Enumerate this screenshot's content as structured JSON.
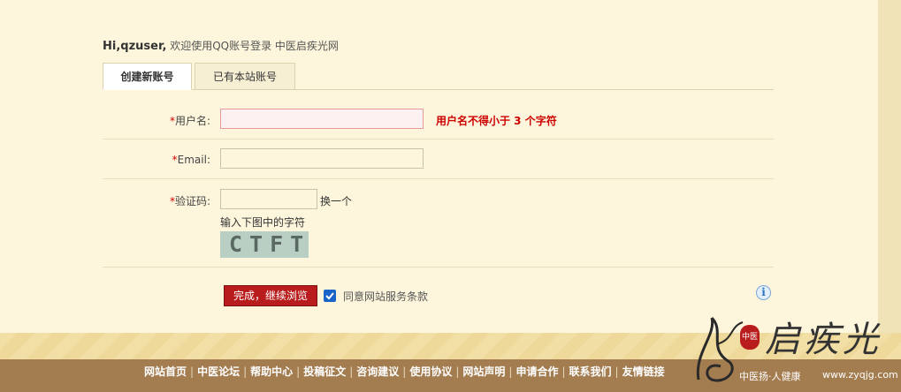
{
  "greeting": {
    "hi": "Hi,qzuser,",
    "message": " 欢迎使用QQ账号登录 中医启疾光网"
  },
  "tabs": [
    {
      "label": "创建新账号",
      "active": true
    },
    {
      "label": "已有本站账号",
      "active": false
    }
  ],
  "form": {
    "required_mark": "*",
    "username": {
      "label": "用户名:",
      "value": "",
      "error": "用户名不得小于 3 个字符"
    },
    "email": {
      "label": "Email:",
      "value": ""
    },
    "captcha": {
      "label": "验证码:",
      "value": "",
      "refresh": "换一个",
      "hint": "输入下图中的字符",
      "image_text": "CTFT"
    },
    "submit": "完成，继续浏览",
    "agree": {
      "checked": true,
      "label": "同意网站服务条款"
    },
    "info_icon": "i"
  },
  "footer": {
    "links": [
      "网站首页",
      "中医论坛",
      "帮助中心",
      "投稿征文",
      "咨询建议",
      "使用协议",
      "网站声明",
      "申请合作",
      "联系我们",
      "友情链接"
    ],
    "separator": "|"
  },
  "logo": {
    "name": "启疾光",
    "seal": "中医",
    "slogan": "中医扬·人健康",
    "url": "www.zyqjg.com"
  },
  "colors": {
    "accent_red": "#b81c1c",
    "background": "#fdf6dc",
    "footer": "#a37c4f",
    "checkbox_blue": "#1a63c9"
  }
}
